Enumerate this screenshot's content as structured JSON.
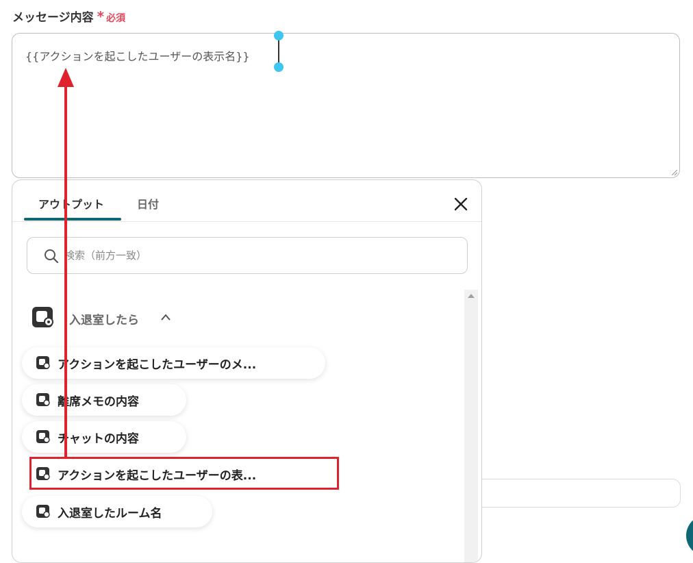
{
  "field": {
    "label": "メッセージ内容",
    "required_star": "*",
    "required_text": "必須",
    "value": "{{アクションを起こしたユーザーの表示名}}"
  },
  "panel": {
    "tabs": [
      {
        "label": "アウトプット",
        "active": true
      },
      {
        "label": "日付",
        "active": false
      }
    ],
    "search": {
      "placeholder": "検索（前方一致）",
      "value": ""
    },
    "group": {
      "title": "入退室したら",
      "expanded": true
    },
    "items": [
      {
        "label": "アクションを起こしたユーザーのメ..."
      },
      {
        "label": "離席メモの内容"
      },
      {
        "label": "チャットの内容"
      },
      {
        "label": "アクションを起こしたユーザーの表...",
        "highlighted": true
      },
      {
        "label": "入退室したルーム名"
      }
    ]
  },
  "colors": {
    "accent": "#0f6675",
    "required": "#e5485a",
    "annotation": "#e0212e",
    "handle": "#3ec6f0"
  }
}
